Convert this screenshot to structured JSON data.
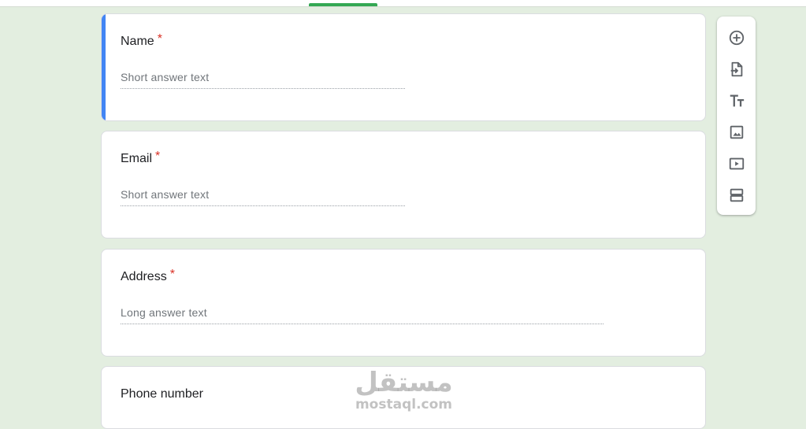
{
  "questions": [
    {
      "title": "Name",
      "required_mark": "*",
      "answer_placeholder": "Short answer text"
    },
    {
      "title": "Email",
      "required_mark": "*",
      "answer_placeholder": "Short answer text"
    },
    {
      "title": "Address",
      "required_mark": "*",
      "answer_placeholder": "Long answer text"
    },
    {
      "title": "Phone number"
    }
  ],
  "toolbar": {
    "icons": [
      "add-question-icon",
      "import-questions-icon",
      "add-title-icon",
      "add-image-icon",
      "add-video-icon",
      "add-section-icon"
    ]
  },
  "watermark": {
    "arabic": "مستقل",
    "latin": "mostaql.com"
  },
  "colors": {
    "background": "#e3eee0",
    "active_accent": "#4285f4",
    "required": "#d93025",
    "topbar_accent": "#34a853"
  }
}
